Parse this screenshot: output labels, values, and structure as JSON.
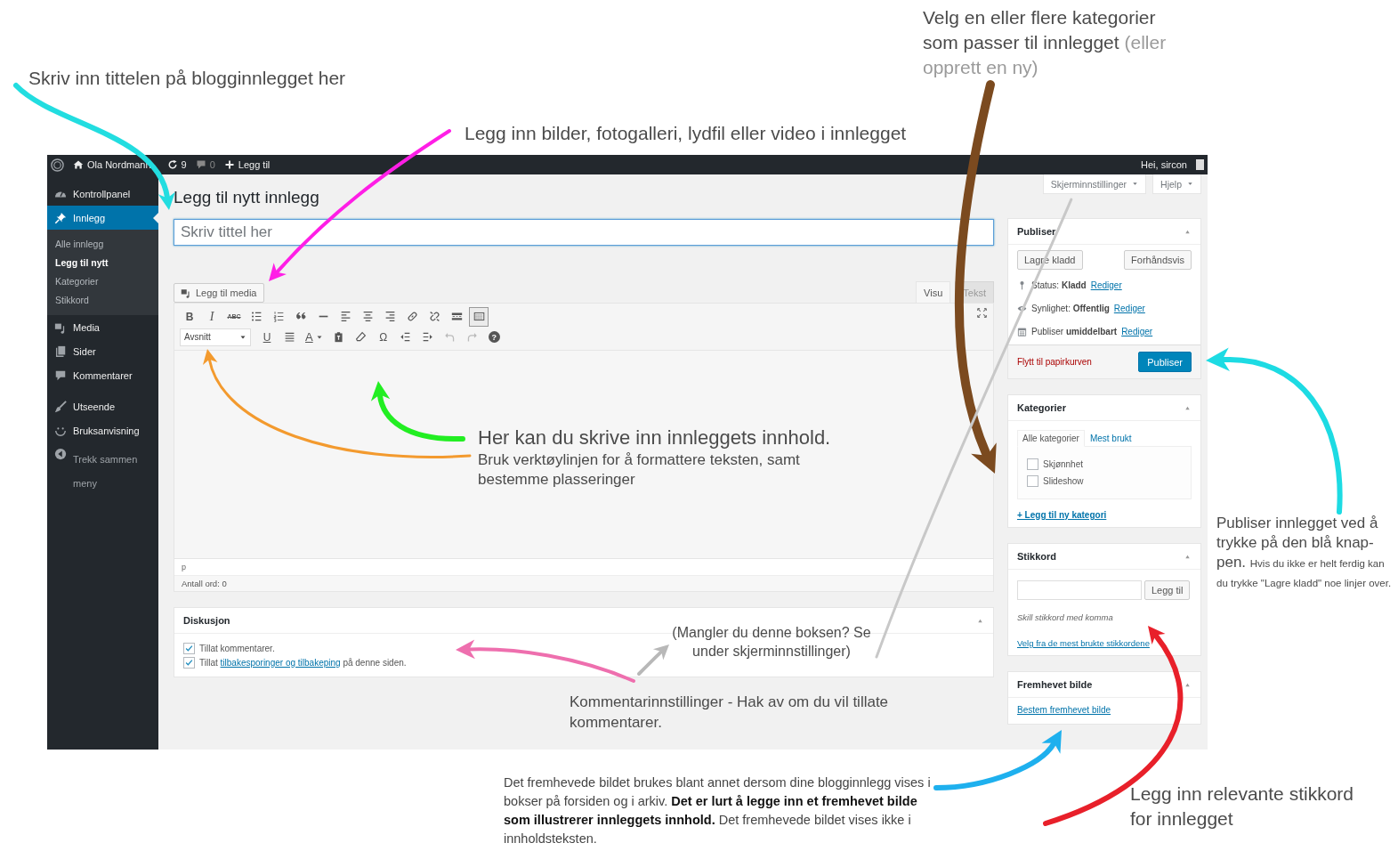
{
  "annotations": [
    {
      "kind": "plain",
      "text": "Skriv inn tittelen på blogginnlegget her"
    },
    {
      "kind": "plain",
      "text": "Legg inn bilder, fotogalleri, lydfil eller video i innlegget"
    },
    {
      "kind": "aside",
      "text": "Velg en eller flere kategorier som passer til innlegget",
      "aside": "(eller opprett en ny)"
    },
    {
      "kind": "heading",
      "title": "Her kan du skrive inn innleggets innhold.",
      "text": "Bruk verktøylinjen for å formattere teksten, samt bestemme plasseringer"
    },
    {
      "kind": "plain",
      "text": "(Mangler du denne boksen? Se under skjerminnstillinger)"
    },
    {
      "kind": "plain",
      "text": "Kommentarinnstillinger - Hak av om du vil tillate kommentarer."
    },
    {
      "kind": "lead",
      "title": "Publiser innlegget ved å trykke på den blå knap-pen.",
      "text": "Hvis du ikke er helt ferdig kan du trykke \"Lagre kladd\"  noe linjer over."
    },
    {
      "kind": "plain",
      "text": "Det fremhevede bildet brukes blant annet dersom dine blogginnlegg vises i bokser på forsiden og i arkiv. **Det er lurt å legge inn et fremhevet bilde som illustrerer innleggets innhold.** Det fremhevede bildet vises ikke i innholdsteksten."
    },
    {
      "kind": "plain",
      "text": "Legg inn relevante stikkord for innlegget"
    }
  ],
  "arrows": [
    {
      "color": "#22dde0"
    },
    {
      "color": "#ff1ee6"
    },
    {
      "color": "#7b4a1f"
    },
    {
      "color": "#f39a2e"
    },
    {
      "color": "#22ee22"
    },
    {
      "color": "#ee6fae"
    },
    {
      "color": "#c8c8c8"
    },
    {
      "color": "#b8b8b8"
    },
    {
      "color": "#1ddbe3"
    },
    {
      "color": "#1eb0ee"
    },
    {
      "color": "#e8202a"
    }
  ],
  "admin_bar": {
    "items": [
      {
        "kind": "icon"
      },
      {
        "kind": "link",
        "label": "Ola Nordmann"
      },
      {
        "kind": "link",
        "label": "9"
      },
      {
        "kind": "link",
        "label": "0"
      },
      {
        "kind": "link",
        "label": "Legg til"
      }
    ],
    "greeting": "Hei, sircon"
  },
  "sidebar": {
    "items": [
      {
        "label": "Kontrollpanel",
        "selected": false
      },
      {
        "label": "Innlegg",
        "selected": true,
        "children": [
          {
            "label": "Alle innlegg",
            "selected": false
          },
          {
            "label": "Legg til nytt",
            "selected": true
          },
          {
            "label": "Kategorier",
            "selected": false
          },
          {
            "label": "Stikkord",
            "selected": false
          }
        ]
      },
      {
        "label": "Media",
        "selected": false
      },
      {
        "label": "Sider",
        "selected": false
      },
      {
        "label": "Kommentarer",
        "selected": false
      },
      {
        "label": "Utseende",
        "selected": false
      },
      {
        "label": "Bruksanvisning",
        "selected": false
      },
      {
        "label": "Trekk sammen meny",
        "selected": false
      }
    ]
  },
  "screen_tabs": [
    {
      "label": "Skjerminnstillinger"
    },
    {
      "label": "Hjelp"
    }
  ],
  "editor": {
    "title": "Legg til nytt innlegg",
    "title_field": {
      "placeholder": "Skriv tittel her"
    },
    "media_button": "Legg til media",
    "tabs": [
      {
        "label": "Visu",
        "selected": true
      },
      {
        "label": "Tekst",
        "selected": false
      }
    ],
    "toolbar_rows": [
      [
        {
          "kind": "text",
          "label": "B",
          "pressed": false
        },
        {
          "kind": "text",
          "label": "I",
          "pressed": false
        },
        {
          "kind": "text",
          "label": "ABC",
          "pressed": false
        },
        {
          "kind": "icon",
          "pressed": false
        },
        {
          "kind": "icon",
          "pressed": false
        },
        {
          "kind": "icon",
          "pressed": false
        },
        {
          "kind": "icon",
          "pressed": false
        },
        {
          "kind": "icon",
          "pressed": false
        },
        {
          "kind": "icon",
          "pressed": false
        },
        {
          "kind": "icon",
          "pressed": false
        },
        {
          "kind": "icon",
          "pressed": false
        },
        {
          "kind": "icon",
          "pressed": false
        },
        {
          "kind": "icon",
          "pressed": false
        },
        {
          "kind": "icon",
          "pressed": true
        }
      ],
      [
        {
          "kind": "select",
          "label": "Avsnitt",
          "pressed": false
        },
        {
          "kind": "text",
          "label": "U",
          "pressed": false
        },
        {
          "kind": "icon",
          "pressed": false
        },
        {
          "kind": "color",
          "label": "A",
          "pressed": false
        },
        {
          "kind": "icon",
          "pressed": false
        },
        {
          "kind": "icon",
          "pressed": false
        },
        {
          "kind": "text",
          "label": "Ω",
          "pressed": false
        },
        {
          "kind": "icon",
          "pressed": false
        },
        {
          "kind": "icon",
          "pressed": false
        },
        {
          "kind": "icon",
          "pressed": false
        },
        {
          "kind": "icon",
          "pressed": false
        },
        {
          "kind": "text",
          "label": "?",
          "pressed": false
        }
      ]
    ],
    "path": "p",
    "word_count": "Antall ord: 0"
  },
  "discussion": {
    "title": "Diskusjon",
    "options": [
      {
        "text": "Tillat kommentarer.",
        "checked": true
      },
      {
        "text": "Tillat",
        "link": "tilbakesporinger og tilbakeping",
        "after": "på denne siden.",
        "checked": true
      }
    ]
  },
  "publish": {
    "title": "Publiser",
    "save_draft": "Lagre kladd",
    "preview": "Forhåndsvis",
    "meta": [
      {
        "text": "Status: **Kladd**",
        "link": "Rediger"
      },
      {
        "text": "Synlighet: **Offentlig**",
        "link": "Rediger"
      },
      {
        "text": "Publiser **umiddelbart**",
        "link": "Rediger"
      }
    ],
    "trash": "Flytt til papirkurven",
    "publish_button": "Publiser"
  },
  "categories": {
    "title": "Kategorier",
    "tabs": [
      {
        "label": "Alle kategorier",
        "selected": true
      },
      {
        "label": "Mest brukt",
        "selected": false
      }
    ],
    "items": [
      {
        "label": "Skjønnhet",
        "checked": false
      },
      {
        "label": "Slideshow",
        "checked": false
      }
    ],
    "add_link": "+ Legg til ny kategori"
  },
  "tags": {
    "title": "Stikkord",
    "add_button": "Legg til",
    "hint": "Skill stikkord med komma",
    "choose_link": "Velg fra de mest brukte stikkordene"
  },
  "featured": {
    "title": "Fremhevet bilde",
    "link": "Bestem fremhevet bilde"
  }
}
